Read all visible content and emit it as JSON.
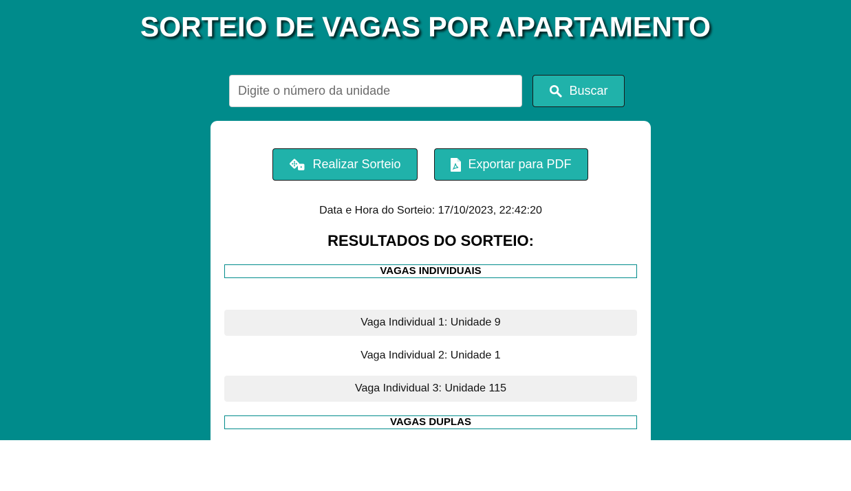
{
  "header": {
    "title": "SORTEIO DE VAGAS POR APARTAMENTO"
  },
  "search": {
    "placeholder": "Digite o número da unidade",
    "value": "",
    "button_label": "Buscar",
    "button_icon": "search-icon"
  },
  "actions": {
    "draw_label": "Realizar Sorteio",
    "draw_icon": "dice-icon",
    "pdf_label": "Exportar para PDF",
    "pdf_icon": "file-pdf-icon"
  },
  "draw_info": {
    "datetime_label": "Data e Hora do Sorteio: 17/10/2023, 22:42:20"
  },
  "results": {
    "title": "RESULTADOS DO SORTEIO:",
    "individual_header": "VAGAS INDIVIDUAIS",
    "individual": [
      "Vaga Individual 1: Unidade 9",
      "Vaga Individual 2: Unidade 1",
      "Vaga Individual 3: Unidade 115"
    ],
    "double_header": "VAGAS DUPLAS"
  },
  "colors": {
    "background": "#008b8b",
    "button": "#20b2aa",
    "row_shade": "#f0f0f0"
  }
}
